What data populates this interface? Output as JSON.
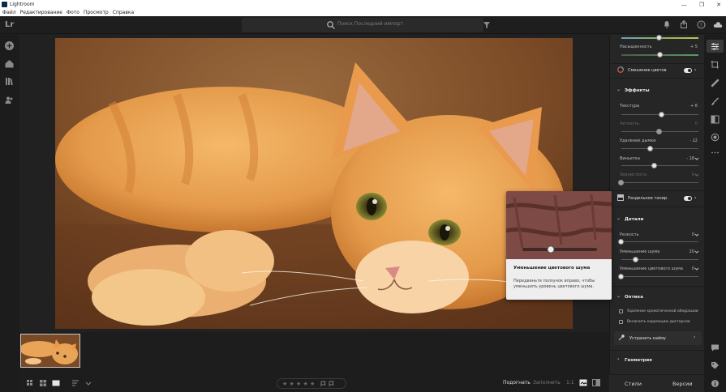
{
  "window": {
    "title": "Lightroom",
    "controls": [
      "—",
      "❐",
      "✕"
    ]
  },
  "menu": [
    "Файл",
    "Редактирование",
    "Фото",
    "Просмотр",
    "Справка"
  ],
  "topbar": {
    "logo": "Lr",
    "search_placeholder": "Поиск Последний импорт"
  },
  "bottombar": {
    "stars": "★ ★ ★ ★ ★",
    "fit": "Подогнать",
    "fill": "Заполнить",
    "ratio": "1:1"
  },
  "panel": {
    "saturation": {
      "label": "Насыщенность",
      "value": "+ 5"
    },
    "color_mixer": {
      "label": "Смешение цветов"
    },
    "effects": {
      "title": "Эффекты",
      "rows": [
        {
          "label": "Текстура",
          "value": "+ 6",
          "level": 0.43,
          "dim": false
        },
        {
          "label": "Четкость",
          "value": "0",
          "level": 0.5,
          "dim": true
        },
        {
          "label": "Удаление дымки",
          "value": "- 22",
          "level": 0.39,
          "dim": false
        },
        {
          "label": "Виньетка",
          "value": "- 18",
          "level": 0.45,
          "dim": false
        },
        {
          "label": "Зернистость",
          "value": "0",
          "level": 0.0,
          "dim": true
        }
      ]
    },
    "split_toning": {
      "label": "Раздельное тонир."
    },
    "details": {
      "title": "Детали",
      "rows": [
        {
          "label": "Резкость",
          "value": "0",
          "level": 0.0,
          "dim": false
        },
        {
          "label": "Уменьшение шума",
          "value": "20",
          "level": 0.2,
          "dim": false
        },
        {
          "label": "Уменьшение цветового шума",
          "value": "0",
          "level": 0.0,
          "dim": false
        }
      ]
    },
    "optics": {
      "title": "Оптика",
      "checks": [
        "Удаление хроматической аберрации",
        "Включить коррекцию дисторсии"
      ],
      "defringe": "Устранить кайму"
    },
    "geometry": {
      "title": "Геометрия"
    },
    "footer": {
      "presets": "Стили",
      "versions": "Версии"
    }
  },
  "tooltip": {
    "title": "Уменьшение цветового шума",
    "text": "Передвиньте ползунок вправо, чтобы уменьшить уровень цветового шума."
  }
}
